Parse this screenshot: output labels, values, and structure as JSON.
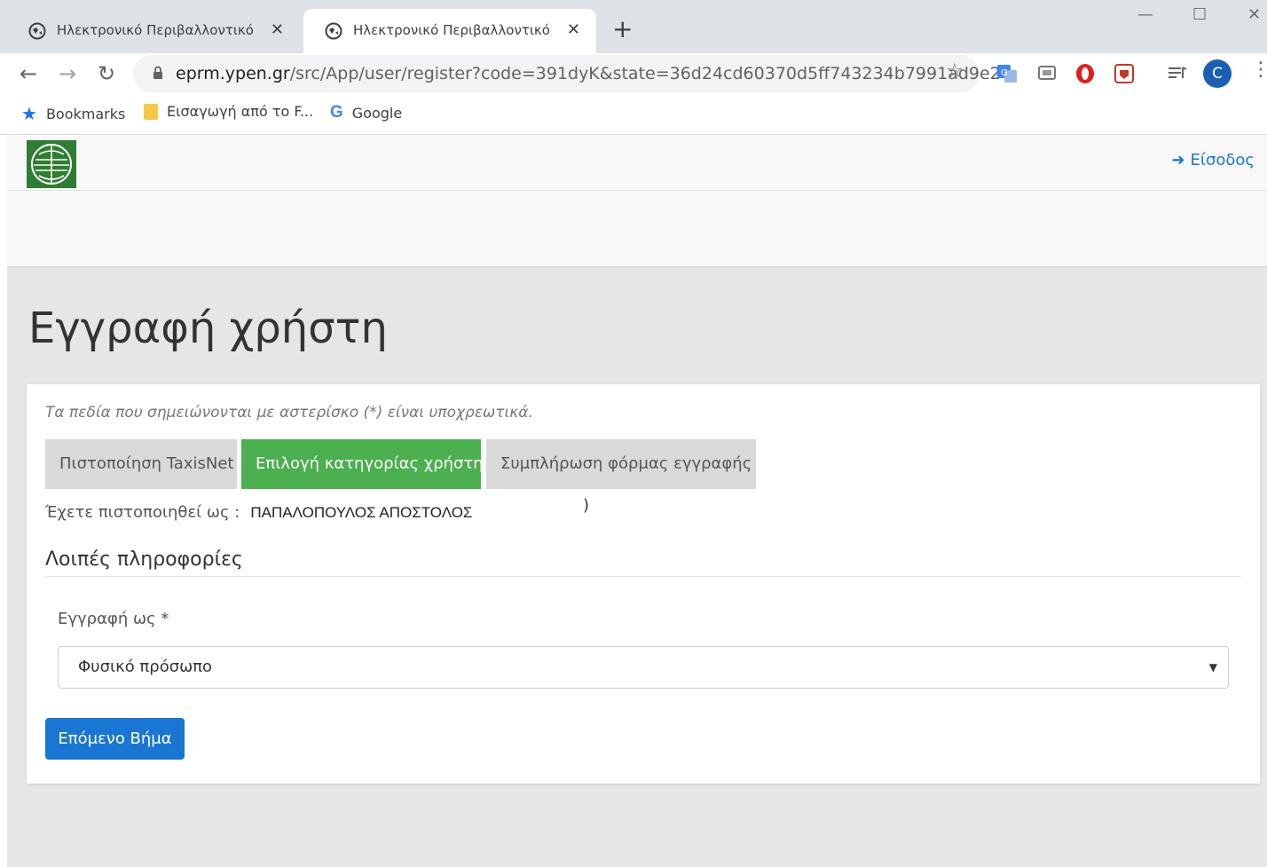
{
  "browser": {
    "tabs": [
      {
        "title": "Ηλεκτρονικό Περιβαλλοντικό Μ",
        "active": false
      },
      {
        "title": "Ηλεκτρονικό Περιβαλλοντικό Μ",
        "active": true
      }
    ],
    "new_tab_label": "+",
    "close_label": "✕",
    "url_domain": "eprm.ypen.gr",
    "url_path": "/src/App/user/register?code=391dyK&state=36d24cd60370d5ff743234b7991ad9e2",
    "avatar_letter": "C",
    "bookmarks": [
      {
        "label": "Bookmarks",
        "icon": "star-icon"
      },
      {
        "label": "Εισαγωγή από το F...",
        "icon": "folder-icon"
      },
      {
        "label": "Google",
        "icon": "google-icon"
      }
    ],
    "accent_color": "#1a73e8"
  },
  "header": {
    "login_label": "Είσοδος"
  },
  "page": {
    "title": "Εγγραφή χρήστη",
    "required_note": "Τα πεδία που σημειώνονται με αστερίσκο (*) είναι υποχρεωτικά.",
    "steps": [
      {
        "label": "Πιστοποίηση TaxisNet",
        "state": "done"
      },
      {
        "label": "Επιλογή κατηγορίας χρήστη",
        "state": "active"
      },
      {
        "label": "Συμπλήρωση φόρμας εγγραφής",
        "state": "pending"
      }
    ],
    "auth_label": "Έχετε πιστοποιηθεί ως :",
    "auth_name": "ΠΑΠΑΛΟΠΟΥΛΟΣ ΑΠΟΣΤΟΛΟΣ",
    "auth_close_paren": ")",
    "section_title": "Λοιπές πληροφορίες",
    "register_as_label": "Εγγραφή ως *",
    "register_as_value": "Φυσικό πρόσωπο",
    "next_button": "Επόμενο Βήμα",
    "step_active_color": "#4caf50",
    "button_color": "#1976d2"
  }
}
